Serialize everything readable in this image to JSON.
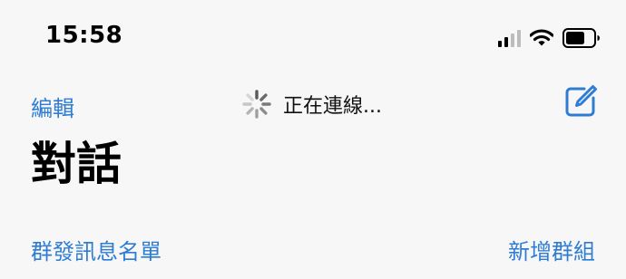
{
  "status_bar": {
    "time": "15:58",
    "icons": [
      "cellular-signal-icon",
      "wifi-icon",
      "battery-icon"
    ]
  },
  "nav": {
    "edit_label": "編輯",
    "status_text": "正在連線...",
    "compose_icon": "compose-icon",
    "spinner_icon": "spinner-icon"
  },
  "title": "對話",
  "actions": {
    "broadcast_label": "群發訊息名單",
    "new_group_label": "新增群組"
  },
  "colors": {
    "accent": "#2f7dd3",
    "background": "#f7f7f7"
  }
}
